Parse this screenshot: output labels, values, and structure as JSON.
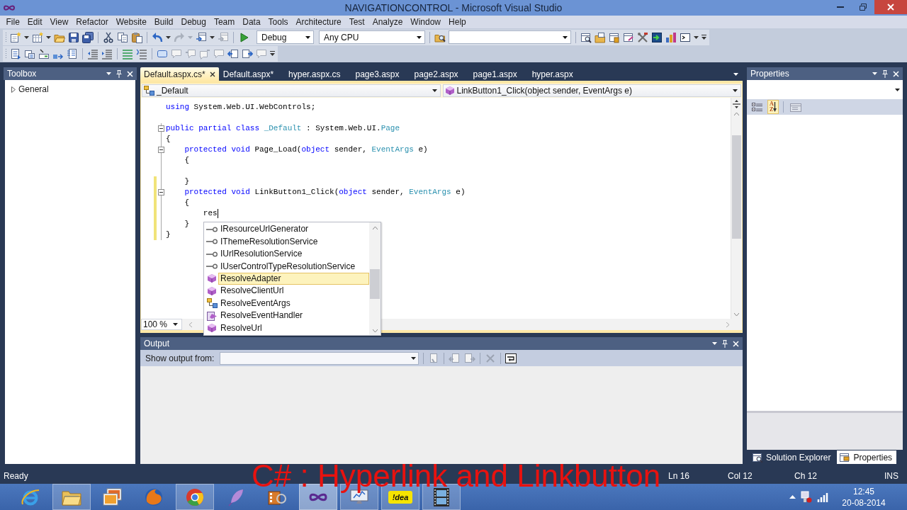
{
  "window": {
    "title": "NAVIGATIONCONTROL - Microsoft Visual Studio"
  },
  "menu": [
    "File",
    "Edit",
    "View",
    "Refactor",
    "Website",
    "Build",
    "Debug",
    "Team",
    "Data",
    "Tools",
    "Architecture",
    "Test",
    "Analyze",
    "Window",
    "Help"
  ],
  "toolbar": {
    "configuration": "Debug",
    "platform": "Any CPU"
  },
  "toolbox": {
    "title": "Toolbox",
    "groups": [
      {
        "label": "General",
        "expanded": false
      }
    ]
  },
  "editor": {
    "tabs": [
      {
        "label": "Default.aspx.cs*",
        "selected": true
      },
      {
        "label": "Default.aspx*",
        "selected": false
      },
      {
        "label": "hyper.aspx.cs",
        "selected": false
      },
      {
        "label": "page3.aspx",
        "selected": false
      },
      {
        "label": "page2.aspx",
        "selected": false
      },
      {
        "label": "page1.aspx",
        "selected": false
      },
      {
        "label": "hyper.aspx",
        "selected": false
      }
    ],
    "type_selector": "_Default",
    "member_selector": "LinkButton1_Click(object sender, EventArgs e)",
    "lines": [
      {
        "tokens": [
          {
            "kind": "keyword",
            "text": "using"
          },
          {
            "kind": "plain",
            "text": " System.Web.UI.WebControls;"
          }
        ],
        "fold": false,
        "changed": false,
        "caret": false
      },
      {
        "fold": false,
        "changed": false,
        "caret": false
      },
      {
        "tokens": [
          {
            "kind": "keyword",
            "text": "public partial class"
          },
          {
            "kind": "type",
            "text": " _Default"
          },
          {
            "kind": "plain",
            "text": " : System.Web.UI."
          },
          {
            "kind": "type",
            "text": "Page"
          }
        ],
        "fold": true,
        "changed": false,
        "caret": false
      },
      {
        "tokens": [
          {
            "kind": "plain",
            "text": "{"
          }
        ],
        "fold": false,
        "changed": false,
        "caret": false,
        "children": [
          {
            "tokens": [
              {
                "kind": "keyword",
                "text": "protected void"
              },
              {
                "kind": "plain",
                "text": " Page_Load("
              },
              {
                "kind": "keyword",
                "text": "object"
              },
              {
                "kind": "plain",
                "text": " sender, "
              },
              {
                "kind": "type",
                "text": "EventArgs"
              },
              {
                "kind": "plain",
                "text": " e)"
              }
            ],
            "fold": true,
            "changed": false,
            "caret": false
          },
          {
            "tokens": [
              {
                "kind": "plain",
                "text": "{"
              }
            ],
            "fold": false,
            "changed": false,
            "caret": false,
            "children": [
              {
                "fold": false,
                "changed": false,
                "caret": false
              }
            ]
          },
          {
            "tokens": [
              {
                "kind": "plain",
                "text": "}"
              }
            ],
            "fold": false,
            "changed": true,
            "caret": false
          },
          {
            "tokens": [
              {
                "kind": "keyword",
                "text": "protected void"
              },
              {
                "kind": "plain",
                "text": " LinkButton1_Click("
              },
              {
                "kind": "keyword",
                "text": "object"
              },
              {
                "kind": "plain",
                "text": " sender, "
              },
              {
                "kind": "type",
                "text": "EventArgs"
              },
              {
                "kind": "plain",
                "text": " e)"
              }
            ],
            "fold": true,
            "changed": true,
            "caret": false
          },
          {
            "tokens": [
              {
                "kind": "plain",
                "text": "{"
              }
            ],
            "fold": false,
            "changed": true,
            "caret": false,
            "children": [
              {
                "tokens": [
                  {
                    "kind": "plain",
                    "text": "res"
                  }
                ],
                "fold": false,
                "changed": true,
                "caret": true
              }
            ]
          },
          {
            "tokens": [
              {
                "kind": "plain",
                "text": "}"
              }
            ],
            "fold": false,
            "changed": true,
            "caret": false
          }
        ]
      },
      {
        "tokens": [
          {
            "kind": "plain",
            "text": "}"
          }
        ],
        "fold": false,
        "changed": true,
        "caret": false
      }
    ],
    "zoom": "100 %",
    "completion": [
      {
        "kind": "interface",
        "label": "IResourceUrlGenerator",
        "selected": false
      },
      {
        "kind": "interface",
        "label": "IThemeResolutionService",
        "selected": false
      },
      {
        "kind": "interface",
        "label": "IUrlResolutionService",
        "selected": false
      },
      {
        "kind": "interface",
        "label": "IUserControlTypeResolutionService",
        "selected": false
      },
      {
        "kind": "method",
        "label": "ResolveAdapter",
        "selected": true
      },
      {
        "kind": "method",
        "label": "ResolveClientUrl",
        "selected": false
      },
      {
        "kind": "class",
        "label": "ResolveEventArgs",
        "selected": false
      },
      {
        "kind": "delegate",
        "label": "ResolveEventHandler",
        "selected": false
      },
      {
        "kind": "method",
        "label": "ResolveUrl",
        "selected": false
      }
    ]
  },
  "output": {
    "title": "Output",
    "source_label": "Show output from:"
  },
  "properties": {
    "title": "Properties",
    "toolbar": [
      {
        "kind": "categorized",
        "selected": false,
        "disabled": false
      },
      {
        "kind": "alphabetical",
        "label": "AZ",
        "selected": true,
        "disabled": false
      },
      {
        "kind": "pages",
        "selected": false,
        "disabled": true
      }
    ]
  },
  "dock_tabs": [
    {
      "kind": "solution",
      "label": "Solution Explorer",
      "selected": false
    },
    {
      "kind": "properties",
      "label": "Properties",
      "selected": true
    }
  ],
  "status_bar": {
    "message": "Ready",
    "line": "Ln 16",
    "column": "Col 12",
    "char": "Ch 12",
    "mode": "INS"
  },
  "taskbar": {
    "apps": [
      {
        "kind": "browser-e",
        "running": false,
        "active": false
      },
      {
        "kind": "folder",
        "running": true,
        "active": false
      },
      {
        "kind": "pictures",
        "running": false,
        "active": false
      },
      {
        "kind": "browser-fox",
        "running": false,
        "active": false
      },
      {
        "kind": "browser-ring",
        "running": true,
        "active": false
      },
      {
        "kind": "feather",
        "running": false,
        "active": false
      },
      {
        "kind": "film-reel",
        "running": false,
        "active": false
      },
      {
        "kind": "infinity",
        "running": true,
        "active": true
      },
      {
        "kind": "monitor",
        "running": true,
        "active": false
      },
      {
        "kind": "badge",
        "label": "!dea",
        "running": true,
        "active": false
      },
      {
        "kind": "filmstrip",
        "running": true,
        "active": false
      }
    ],
    "time": "12:45",
    "date": "20-08-2014"
  },
  "video_caption": "C# : Hyperlink and Linkbutton"
}
